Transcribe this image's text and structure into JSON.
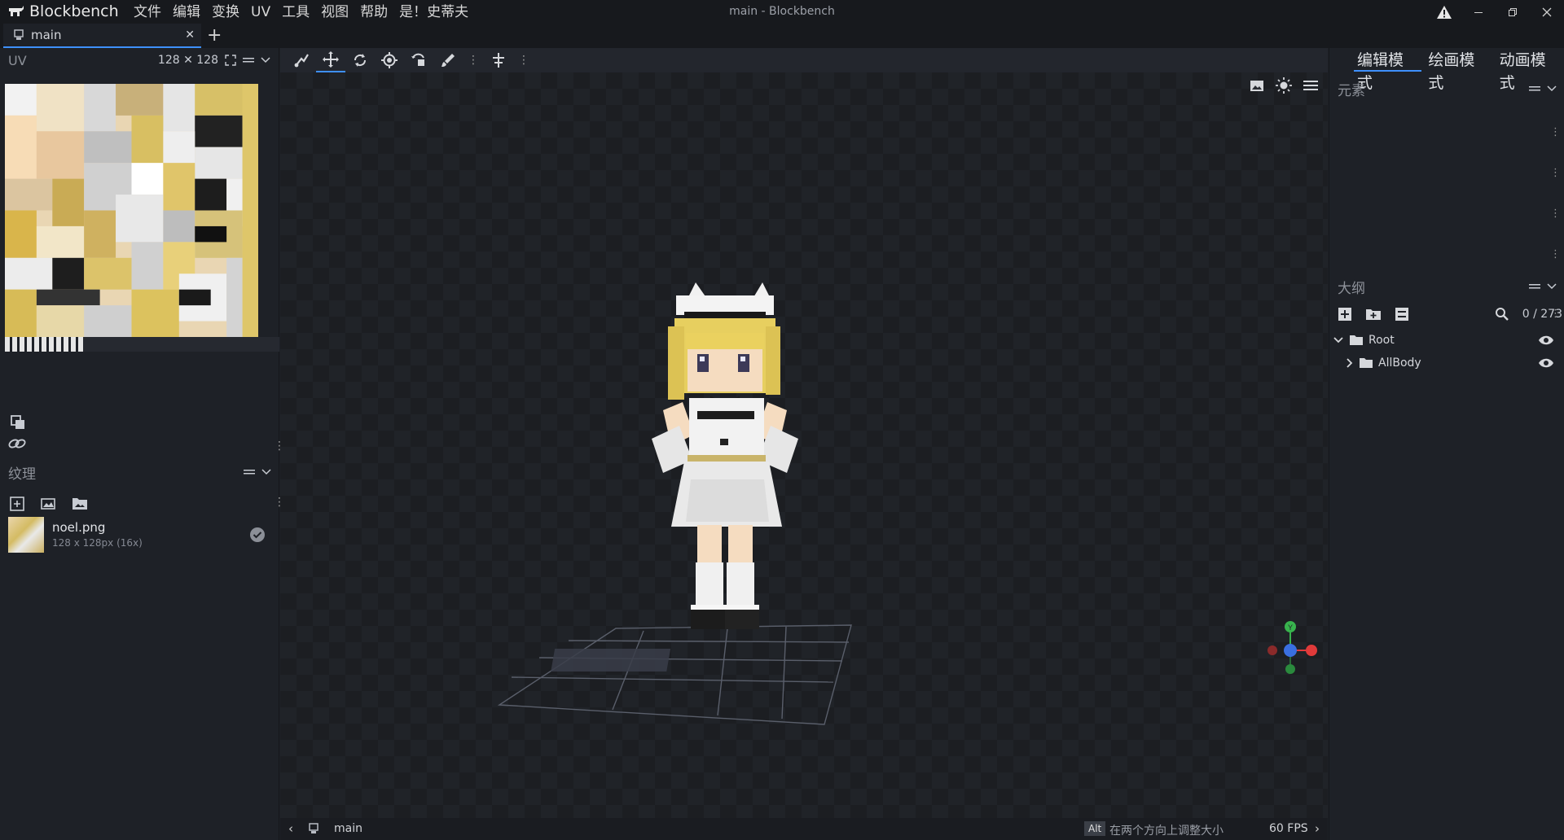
{
  "app": {
    "name": "Blockbench",
    "window_title": "main - Blockbench"
  },
  "menu": [
    "文件",
    "编辑",
    "变换",
    "UV",
    "工具",
    "视图",
    "帮助",
    "是！史蒂夫"
  ],
  "tabs": [
    {
      "label": "main",
      "close": "✕"
    }
  ],
  "tab_add": "+",
  "uv_panel": {
    "title": "UV",
    "size": "128 ✕ 128"
  },
  "textures_panel": {
    "title": "纹理",
    "items": [
      {
        "name": "noel.png",
        "info": "128 x 128px (16x)"
      }
    ]
  },
  "mode_tabs": [
    "编辑模式",
    "绘画模式",
    "动画模式"
  ],
  "elements_panel": {
    "title": "元素"
  },
  "outliner": {
    "title": "大纲",
    "count": "0 / 273",
    "items": [
      {
        "name": "Root"
      },
      {
        "name": "AllBody"
      }
    ]
  },
  "statusbar": {
    "model": "main",
    "alt_key": "Alt",
    "hint": "在两个方向上调整大小",
    "fps": "60 FPS"
  },
  "gizmo": {
    "y_label": "Y"
  },
  "colors": {
    "accent": "#3e90ff",
    "axis_x": "#e03a3a",
    "axis_y": "#38b34d",
    "axis_z": "#3a6fe0"
  }
}
